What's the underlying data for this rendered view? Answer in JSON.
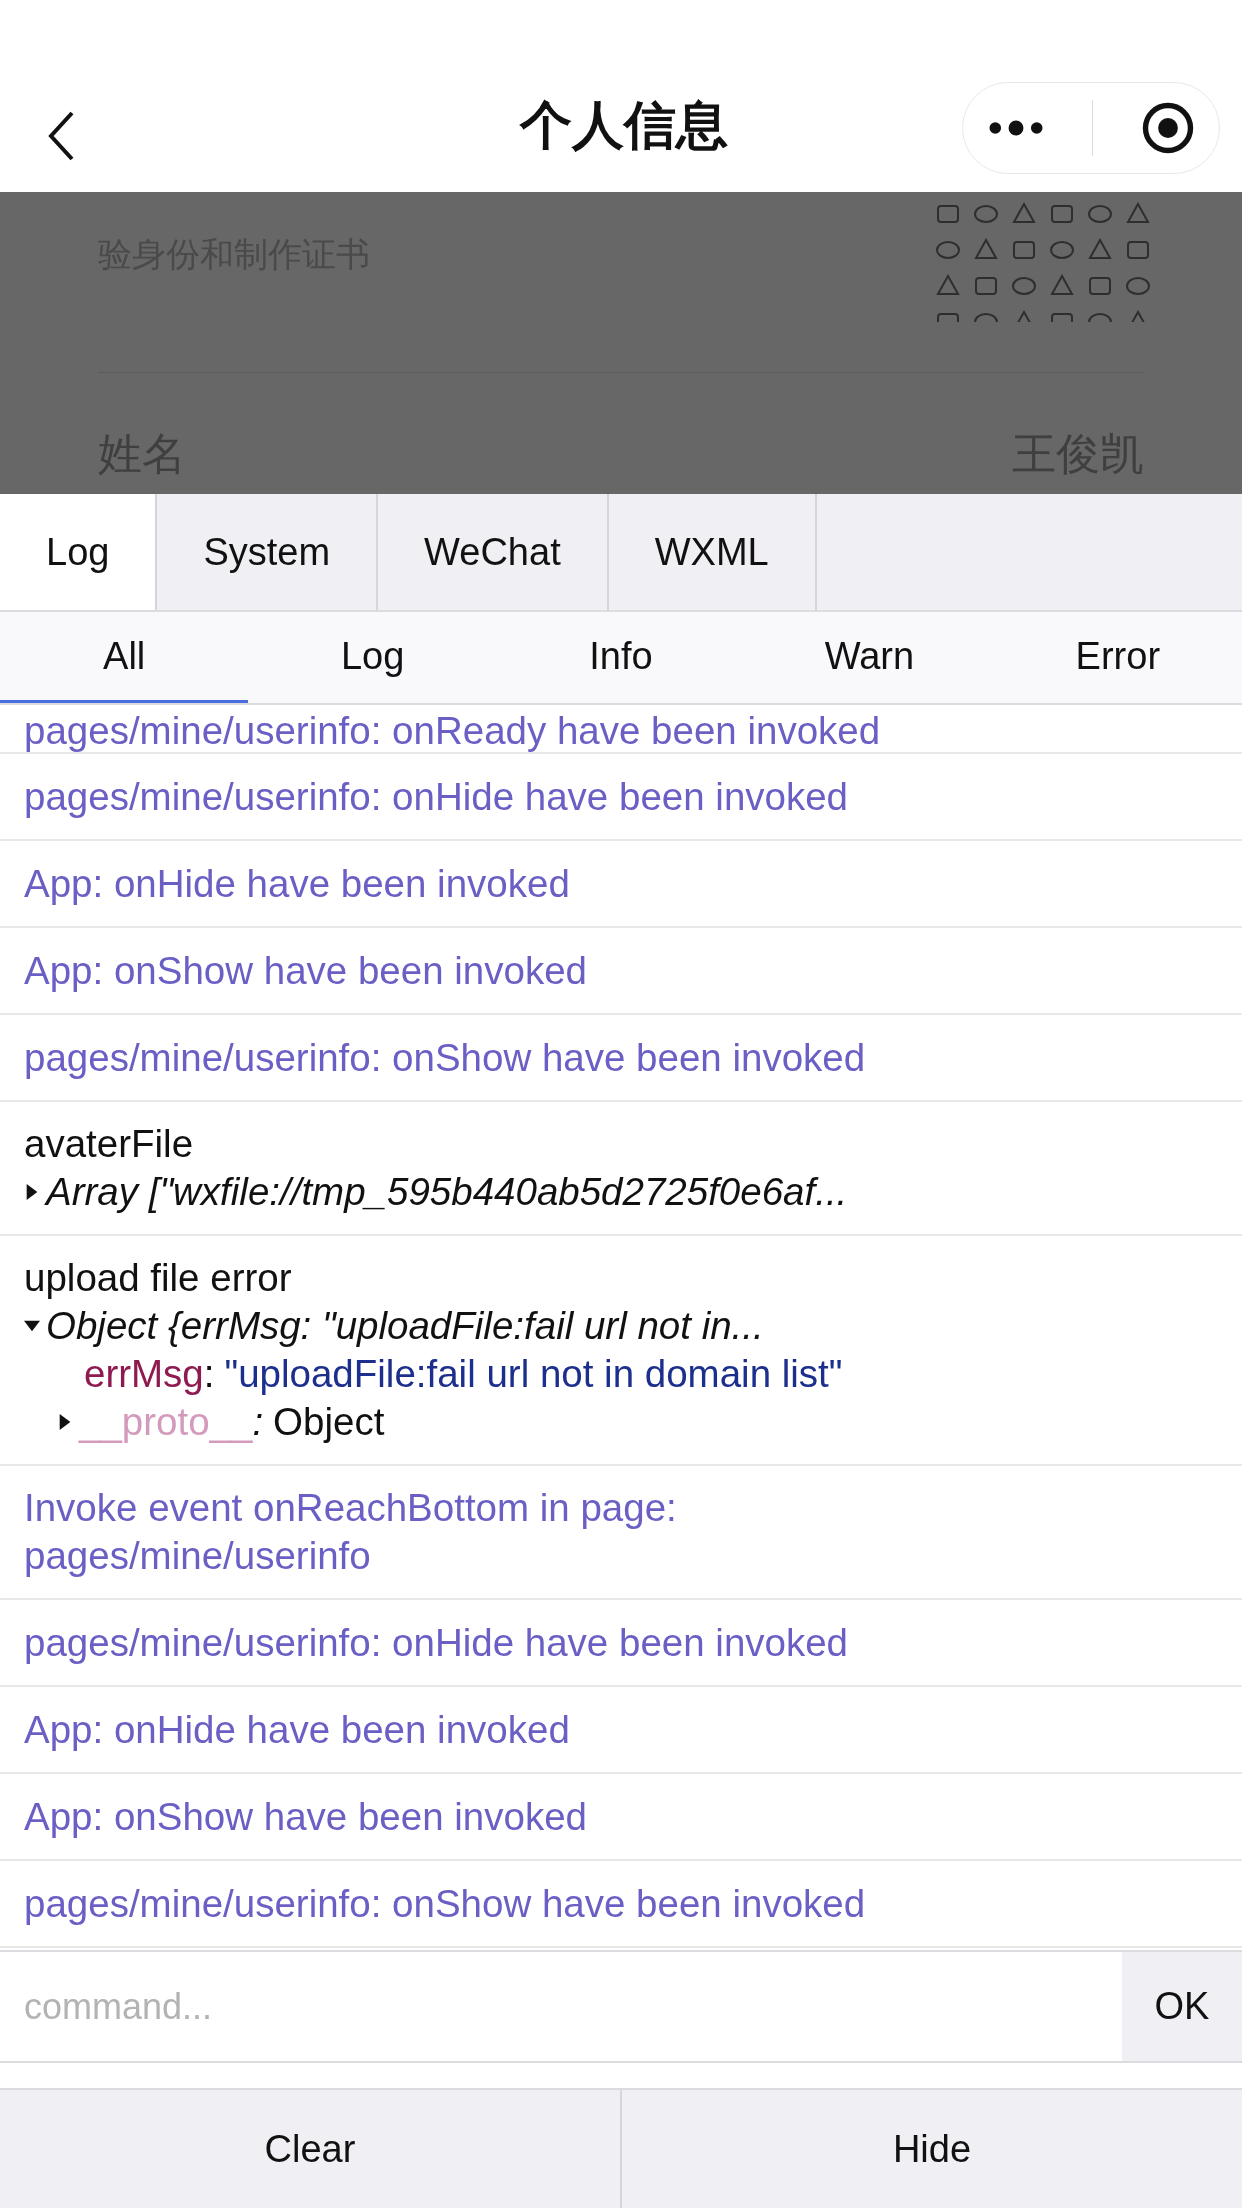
{
  "nav": {
    "title": "个人信息"
  },
  "page": {
    "intro_line": "验身份和制作证书",
    "field": {
      "label": "姓名",
      "value": "王俊凯"
    }
  },
  "tabs": [
    {
      "label": "Log",
      "selected": true
    },
    {
      "label": "System",
      "selected": false
    },
    {
      "label": "WeChat",
      "selected": false
    },
    {
      "label": "WXML",
      "selected": false
    }
  ],
  "filters": [
    {
      "label": "All",
      "selected": true
    },
    {
      "label": "Log",
      "selected": false
    },
    {
      "label": "Info",
      "selected": false
    },
    {
      "label": "Warn",
      "selected": false
    },
    {
      "label": "Error",
      "selected": false
    }
  ],
  "logs": [
    {
      "kind": "info",
      "text": "pages/mine/userinfo: onReady have been invoked",
      "cut": true
    },
    {
      "kind": "info",
      "text": "pages/mine/userinfo: onHide have been invoked",
      "cut": false
    },
    {
      "kind": "info",
      "text": "App: onHide have been invoked",
      "cut": false
    },
    {
      "kind": "info",
      "text": "App: onShow have been invoked",
      "cut": false
    },
    {
      "kind": "info",
      "text": "pages/mine/userinfo: onShow have been invoked",
      "cut": false
    },
    {
      "kind": "log",
      "label": "avaterFile",
      "summary": "Array [\"wxfile://tmp_595b440ab5d2725f0e6af...",
      "expanded": false
    },
    {
      "kind": "log",
      "label": "upload file error",
      "summary": "Object {errMsg: \"uploadFile:fail url not in...",
      "expanded": true,
      "props": [
        {
          "kind": "prop",
          "key": "errMsg",
          "colon": ":",
          "value": "\"uploadFile:fail url not in domain list\""
        },
        {
          "kind": "proto",
          "key": "__proto__",
          "colon": ":",
          "value": "Object",
          "expanded": false
        }
      ]
    },
    {
      "kind": "info",
      "text": "Invoke event onReachBottom in page: pages/mine/userinfo",
      "cut": false
    },
    {
      "kind": "info",
      "text": "pages/mine/userinfo: onHide have been invoked",
      "cut": false
    },
    {
      "kind": "info",
      "text": "App: onHide have been invoked",
      "cut": false
    },
    {
      "kind": "info",
      "text": "App: onShow have been invoked",
      "cut": false
    },
    {
      "kind": "info",
      "text": "pages/mine/userinfo: onShow have been invoked",
      "cut": false
    }
  ],
  "command": {
    "placeholder": "command...",
    "button": "OK"
  },
  "buttons": [
    "Clear",
    "Hide"
  ]
}
